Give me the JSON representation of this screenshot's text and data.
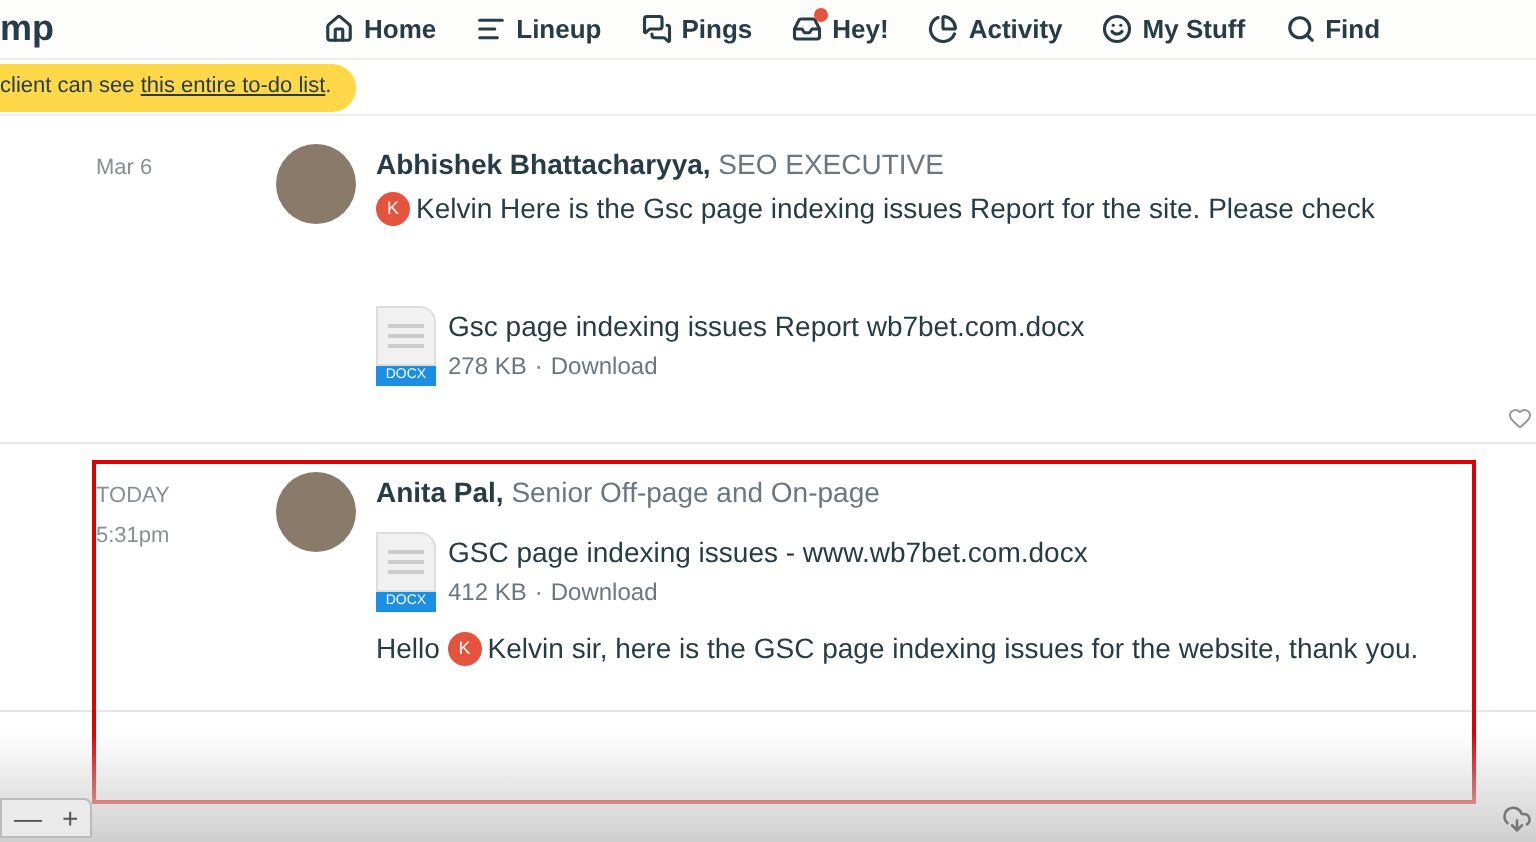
{
  "header": {
    "logo_text": "mp",
    "nav": [
      {
        "label": "Home",
        "badge": false
      },
      {
        "label": "Lineup",
        "badge": false
      },
      {
        "label": "Pings",
        "badge": false
      },
      {
        "label": "Hey!",
        "badge": true
      },
      {
        "label": "Activity",
        "badge": false
      },
      {
        "label": "My Stuff",
        "badge": false
      },
      {
        "label": "Find",
        "badge": false
      }
    ]
  },
  "notice": {
    "before": "client can see ",
    "link": "this entire to-do list",
    "after": "."
  },
  "messages": [
    {
      "date": "Mar 6",
      "author": "Abhishek Bhattacharyya,",
      "role": "SEO EXECUTIVE",
      "highlighted": false,
      "blocks": [
        {
          "kind": "text",
          "mention_initial": "K",
          "rest": "Kelvin Here is the Gsc page indexing issues Report for the site. Please check"
        },
        {
          "kind": "spacer"
        },
        {
          "kind": "file",
          "name": "Gsc page indexing issues Report wb7bet.com.docx",
          "type": "DOCX",
          "size": "278 KB",
          "separator": "·",
          "action": "Download"
        }
      ]
    },
    {
      "date": "TODAY",
      "time": "5:31pm",
      "author": "Anita Pal,",
      "role": "Senior Off-page and On-page",
      "highlighted": true,
      "blocks": [
        {
          "kind": "file",
          "name": "GSC page indexing issues - www.wb7bet.com.docx",
          "type": "DOCX",
          "size": "412 KB",
          "separator": "·",
          "action": "Download"
        },
        {
          "kind": "text",
          "prefix": "Hello ",
          "mention_initial": "K",
          "rest": "Kelvin sir, here is the GSC page indexing issues for the website, thank you."
        }
      ]
    }
  ],
  "zoom": {
    "minus": "—",
    "plus": "+"
  }
}
